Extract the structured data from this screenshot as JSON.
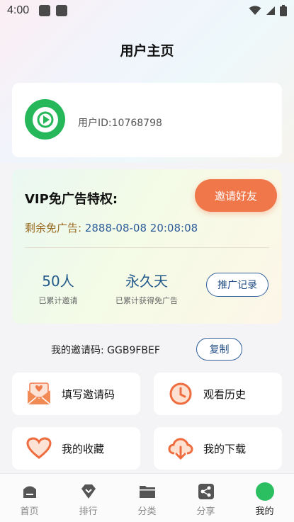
{
  "status": {
    "time": "4:00"
  },
  "header": {
    "title": "用户主页"
  },
  "profile": {
    "user_id": "用户ID:10768798"
  },
  "vip": {
    "title": "VIP免广告特权:",
    "invite_button": "邀请好友",
    "remain_label": "剩余免广告:",
    "remain_value": "2888-08-08 20:08:08",
    "invited_count": "50人",
    "invited_caption": "已累计邀请",
    "days_value": "永久天",
    "days_caption": "已累计获得免广告",
    "promo_button": "推广记录"
  },
  "invite_code": {
    "label": "我的邀请码: GGB9FBEF",
    "copy_button": "复制"
  },
  "tiles": [
    {
      "label": "填写邀请码",
      "icon": "mail-icon"
    },
    {
      "label": "观看历史",
      "icon": "clock-icon"
    },
    {
      "label": "我的收藏",
      "icon": "heart-icon"
    },
    {
      "label": "我的下载",
      "icon": "cloud-download-icon"
    }
  ],
  "nav": [
    {
      "label": "首页",
      "icon": "home-icon"
    },
    {
      "label": "排行",
      "icon": "diamond-icon"
    },
    {
      "label": "分类",
      "icon": "folder-icon"
    },
    {
      "label": "分享",
      "icon": "share-icon"
    },
    {
      "label": "我的",
      "icon": "profile-icon"
    }
  ],
  "colors": {
    "accent_orange": "#f0774a",
    "accent_blue": "#2e5f9c",
    "brand_green": "#26b75a"
  }
}
